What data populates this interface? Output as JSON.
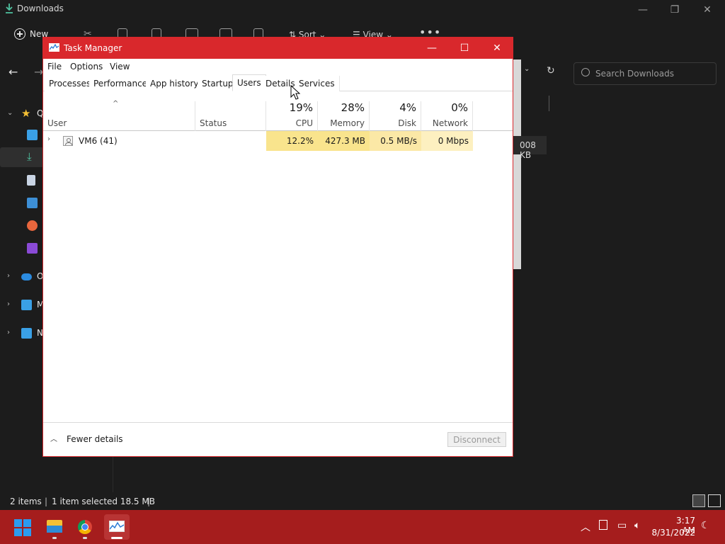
{
  "explorer": {
    "title": "Downloads",
    "toolbar": {
      "new_label": "New",
      "sort_label": "Sort",
      "view_label": "View"
    },
    "search_placeholder": "Search Downloads",
    "sidebar": {
      "quick_access_label": "Q",
      "onedrive_label": "O",
      "this_pc_label": "M",
      "network_label": "N"
    },
    "size_cell": "008 KB",
    "status": {
      "items": "2 items",
      "selected": "1 item selected  18.5 MB"
    }
  },
  "taskmgr": {
    "title": "Task Manager",
    "menu": [
      "File",
      "Options",
      "View"
    ],
    "tabs": [
      "Processes",
      "Performance",
      "App history",
      "Startup",
      "Users",
      "Details",
      "Services"
    ],
    "active_tab": "Users",
    "columns": {
      "user": "User",
      "status": "Status",
      "cpu": {
        "name": "CPU",
        "pct": "19%"
      },
      "memory": {
        "name": "Memory",
        "pct": "28%"
      },
      "disk": {
        "name": "Disk",
        "pct": "4%"
      },
      "network": {
        "name": "Network",
        "pct": "0%"
      }
    },
    "rows": [
      {
        "user": "VM6 (41)",
        "status": "",
        "cpu": "12.2%",
        "memory": "427.3 MB",
        "disk": "0.5 MB/s",
        "network": "0 Mbps"
      }
    ],
    "footer": {
      "fewer_details": "Fewer details",
      "disconnect": "Disconnect"
    }
  },
  "taskbar": {
    "time": "3:17 AM",
    "date": "8/31/2022"
  },
  "colors": {
    "taskmgr_accent": "#d9282c",
    "taskbar": "#a51d1d",
    "heat_cpu": "#f9e48d",
    "heat_memory": "#f9e48d",
    "heat_low": "#fdf0c0"
  }
}
